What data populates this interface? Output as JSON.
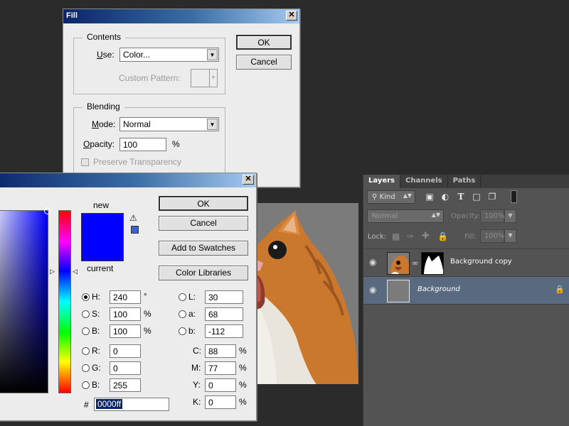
{
  "colors": {
    "new": "#0000ff",
    "current": "#0000ff",
    "titlebar": "#0a246a",
    "selected_layer": "#596a80"
  },
  "fill_dialog": {
    "title": "Fill",
    "contents_group": "Contents",
    "use_label": "Use:",
    "use_value": "Color...",
    "custom_pattern_label": "Custom Pattern:",
    "blending_group": "Blending",
    "mode_label": "Mode:",
    "mode_value": "Normal",
    "opacity_label": "Opacity:",
    "opacity_value": "100",
    "opacity_unit": "%",
    "preserve_transparency": "Preserve Transparency",
    "ok": "OK",
    "cancel": "Cancel"
  },
  "color_picker": {
    "new_label": "new",
    "current_label": "current",
    "ok": "OK",
    "cancel": "Cancel",
    "add_to_swatches": "Add to Swatches",
    "color_libraries": "Color Libraries",
    "hsb": [
      {
        "label": "H:",
        "value": "240",
        "unit": "°",
        "selected": true
      },
      {
        "label": "S:",
        "value": "100",
        "unit": "%",
        "selected": false
      },
      {
        "label": "B:",
        "value": "100",
        "unit": "%",
        "selected": false
      }
    ],
    "rgb": [
      {
        "label": "R:",
        "value": "0"
      },
      {
        "label": "G:",
        "value": "0"
      },
      {
        "label": "B:",
        "value": "255"
      }
    ],
    "lab": [
      {
        "label": "L:",
        "value": "30"
      },
      {
        "label": "a:",
        "value": "68"
      },
      {
        "label": "b:",
        "value": "-112"
      }
    ],
    "cmyk": [
      {
        "label": "C:",
        "value": "88",
        "unit": "%"
      },
      {
        "label": "M:",
        "value": "77",
        "unit": "%"
      },
      {
        "label": "Y:",
        "value": "0",
        "unit": "%"
      },
      {
        "label": "K:",
        "value": "0",
        "unit": "%"
      }
    ],
    "hex_label": "#",
    "hex_value": "0000ff"
  },
  "layers_panel": {
    "tabs": [
      "Layers",
      "Channels",
      "Paths"
    ],
    "filter_kind": "Kind",
    "blend_mode": "Normal",
    "opacity_label": "Opacity:",
    "opacity_value": "100%",
    "lock_label": "Lock:",
    "fill_label": "Fill:",
    "fill_value": "100%",
    "layers": [
      {
        "name": "Background copy",
        "selected": false
      },
      {
        "name": "Background",
        "selected": true
      }
    ]
  }
}
